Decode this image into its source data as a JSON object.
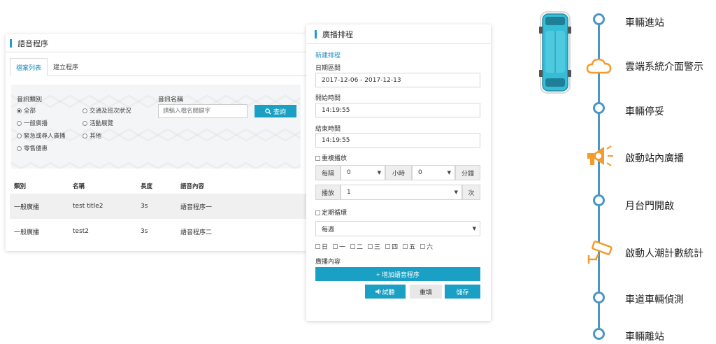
{
  "voice_program": {
    "title": "語音程序",
    "tabs": [
      "檔案列表",
      "建立程序"
    ],
    "filter": {
      "category_label": "音訊類別",
      "options": [
        "全部",
        "交通及班次狀況",
        "一般廣播",
        "活動展覽",
        "緊急或尋人廣播",
        "其他",
        "零售優惠"
      ],
      "selected": "全部",
      "name_label": "音訊名稱",
      "search_placeholder": "請輸入檔名關鍵字",
      "search_button": "查詢"
    },
    "table": {
      "headers": [
        "類別",
        "名稱",
        "長度",
        "語音內容"
      ],
      "rows": [
        [
          "一般廣播",
          "test title2",
          "3s",
          "語音程序一"
        ],
        [
          "一般廣播",
          "test2",
          "3s",
          "語音程序二"
        ]
      ]
    }
  },
  "schedule": {
    "title": "廣播排程",
    "new_link": "新建排程",
    "date_label": "日期區間",
    "date_value": "2017-12-06 - 2017-12-13",
    "start_label": "開始時間",
    "start_value": "14:19:55",
    "end_label": "結束時間",
    "end_value": "14:19:55",
    "repeat_label": "重複播放",
    "every_label": "每隔",
    "hour_value": "0",
    "hour_unit": "小時",
    "minute_value": "0",
    "minute_unit": "分鐘",
    "play_label": "播放",
    "play_value": "1",
    "play_unit": "次",
    "cycle_label": "定期循環",
    "cycle_value": "每週",
    "weekdays": [
      "日",
      "一",
      "二",
      "三",
      "四",
      "五",
      "六"
    ],
    "content_label": "廣播內容",
    "add_button": "+ 增加語音程序",
    "test_button": "試聽",
    "reset_button": "重填",
    "save_button": "儲存"
  },
  "flow": {
    "steps": [
      "車輛進站",
      "雲端系統介面警示",
      "車輛停妥",
      "啟動站內廣播",
      "月台門開啟",
      "啟動人潮計數統計",
      "車道車輛偵測",
      "車輛離站"
    ]
  },
  "colors": {
    "accent": "#1aa0c4",
    "flow_line": "#4a97c5",
    "flow_icon": "#f39c2c",
    "bus_body": "#35bcd6"
  }
}
